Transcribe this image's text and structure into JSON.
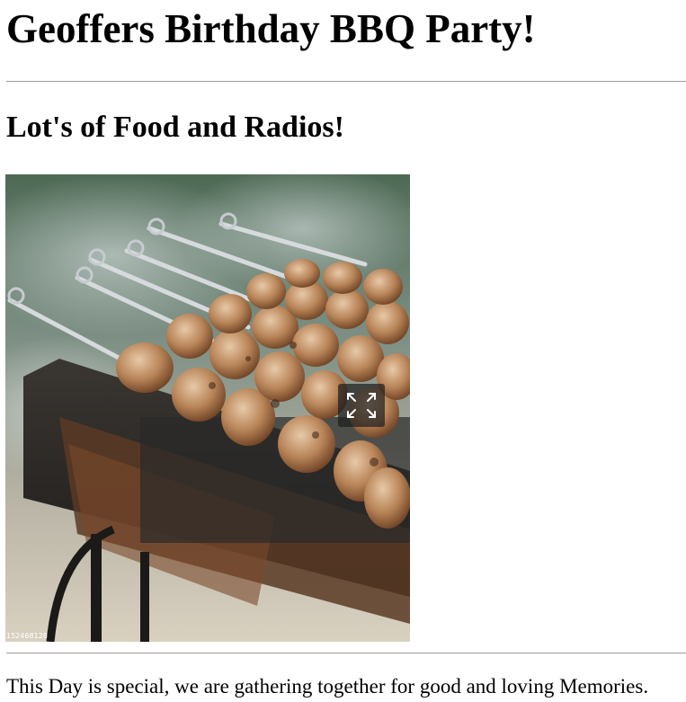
{
  "header": {
    "title": "Geoffers Birthday BBQ Party!"
  },
  "section": {
    "subtitle": "Lot's of Food and Radios!"
  },
  "photo": {
    "id_label": "152468128",
    "expand_icon": "expand-arrows-icon"
  },
  "body": {
    "text": "This Day is special, we are gathering together for good and loving Memories."
  }
}
